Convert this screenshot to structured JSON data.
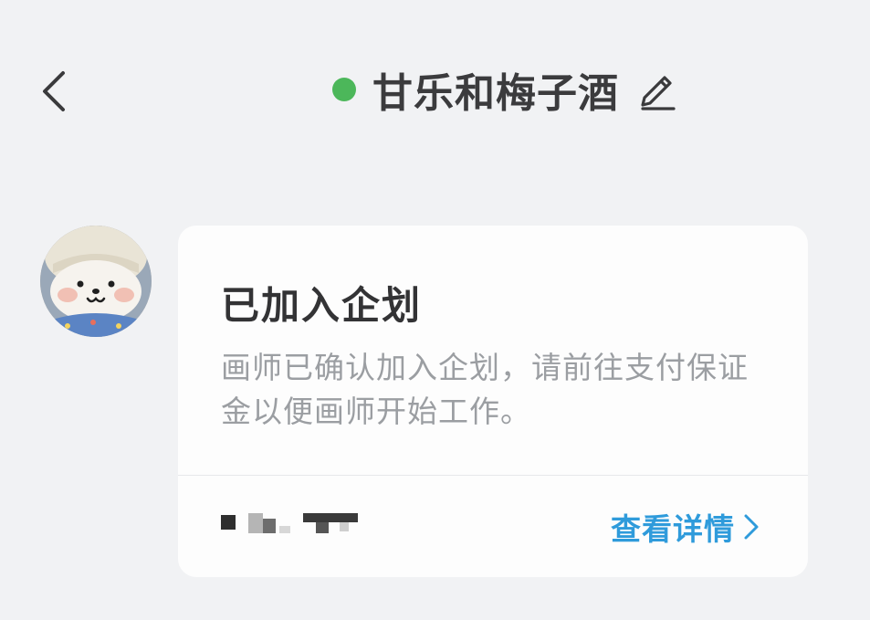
{
  "header": {
    "title": "甘乐和梅子酒",
    "status": "online",
    "status_color": "#4cb75a",
    "back_icon": "chevron-left-icon",
    "edit_icon": "pencil-icon"
  },
  "message": {
    "avatar": "avatar-bear-photo",
    "card": {
      "title": "已加入企划",
      "description": "画师已确认加入企划，请前往支付保证金以便画师开始工作。",
      "detail_link": "查看详情",
      "link_color": "#2f9bdb",
      "link_icon": "chevron-right-icon"
    }
  }
}
